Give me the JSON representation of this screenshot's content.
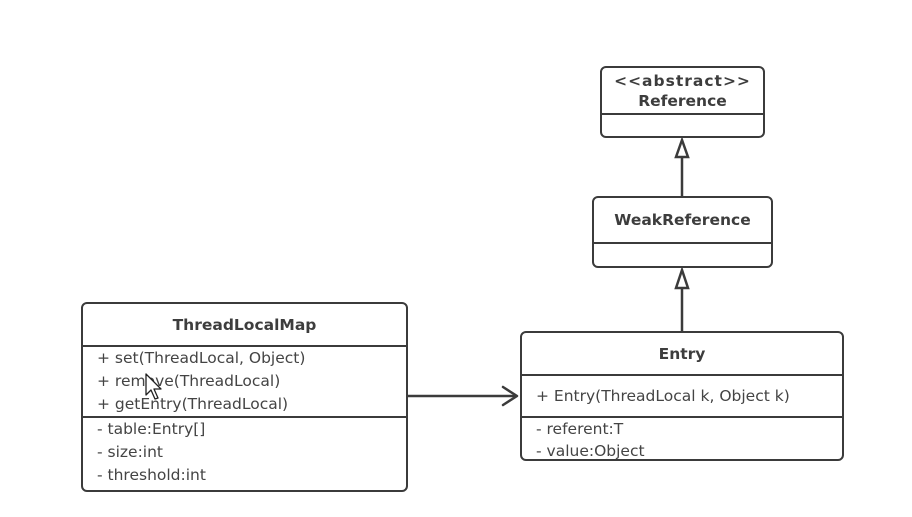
{
  "diagram": {
    "type": "uml-class-diagram",
    "line_color": "#3b3b3b",
    "text_color": "#3d3d3d",
    "background": "#ffffff"
  },
  "classes": {
    "reference": {
      "stereotype": "<<abstract>>",
      "name": "Reference",
      "methods": [],
      "fields": []
    },
    "weak_reference": {
      "name": "WeakReference",
      "methods": [],
      "fields": []
    },
    "thread_local_map": {
      "name": "ThreadLocalMap",
      "methods": [
        "+ set(ThreadLocal, Object)",
        "+ remove(ThreadLocal)",
        "+ getEntry(ThreadLocal)"
      ],
      "fields": [
        "- table:Entry[]",
        "- size:int",
        "- threshold:int"
      ]
    },
    "entry": {
      "name": "Entry",
      "methods": [
        "+ Entry(ThreadLocal k, Object k)"
      ],
      "fields": [
        "- referent:T",
        "- value:Object"
      ]
    }
  },
  "relationships": [
    {
      "type": "inheritance",
      "from": "WeakReference",
      "to": "Reference"
    },
    {
      "type": "inheritance",
      "from": "Entry",
      "to": "WeakReference"
    },
    {
      "type": "association",
      "from": "ThreadLocalMap",
      "to": "Entry"
    }
  ],
  "cursor": {
    "icon": "mouse-pointer-icon"
  }
}
